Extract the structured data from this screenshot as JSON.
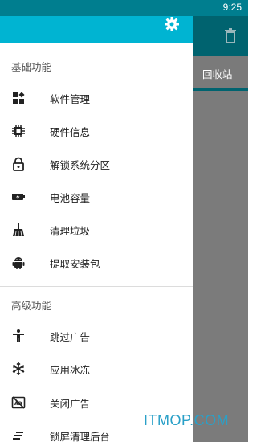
{
  "status_bar": {
    "time": "9:25"
  },
  "background_app": {
    "tab_label": "回收站",
    "trash_icon": "trash-icon"
  },
  "drawer": {
    "header_icon": "gear-icon",
    "sections": [
      {
        "title": "基础功能",
        "items": [
          {
            "label": "软件管理",
            "icon": "apps-icon"
          },
          {
            "label": "硬件信息",
            "icon": "chip-icon"
          },
          {
            "label": "解锁系统分区",
            "icon": "lock-icon"
          },
          {
            "label": "电池容量",
            "icon": "battery-icon"
          },
          {
            "label": "清理垃圾",
            "icon": "broom-icon"
          },
          {
            "label": "提取安装包",
            "icon": "android-icon"
          }
        ]
      },
      {
        "title": "高级功能",
        "items": [
          {
            "label": "跳过广告",
            "icon": "person-icon"
          },
          {
            "label": "应用冰冻",
            "icon": "snowflake-icon"
          },
          {
            "label": "关闭广告",
            "icon": "ad-block-icon"
          },
          {
            "label": "锁屏清理后台",
            "icon": "sweep-icon"
          }
        ]
      }
    ]
  },
  "watermark": "ITMOP.COM",
  "colors": {
    "header": "#00b4d2",
    "status_bar": "#007e8f",
    "watermark": "#2aa0c8"
  }
}
